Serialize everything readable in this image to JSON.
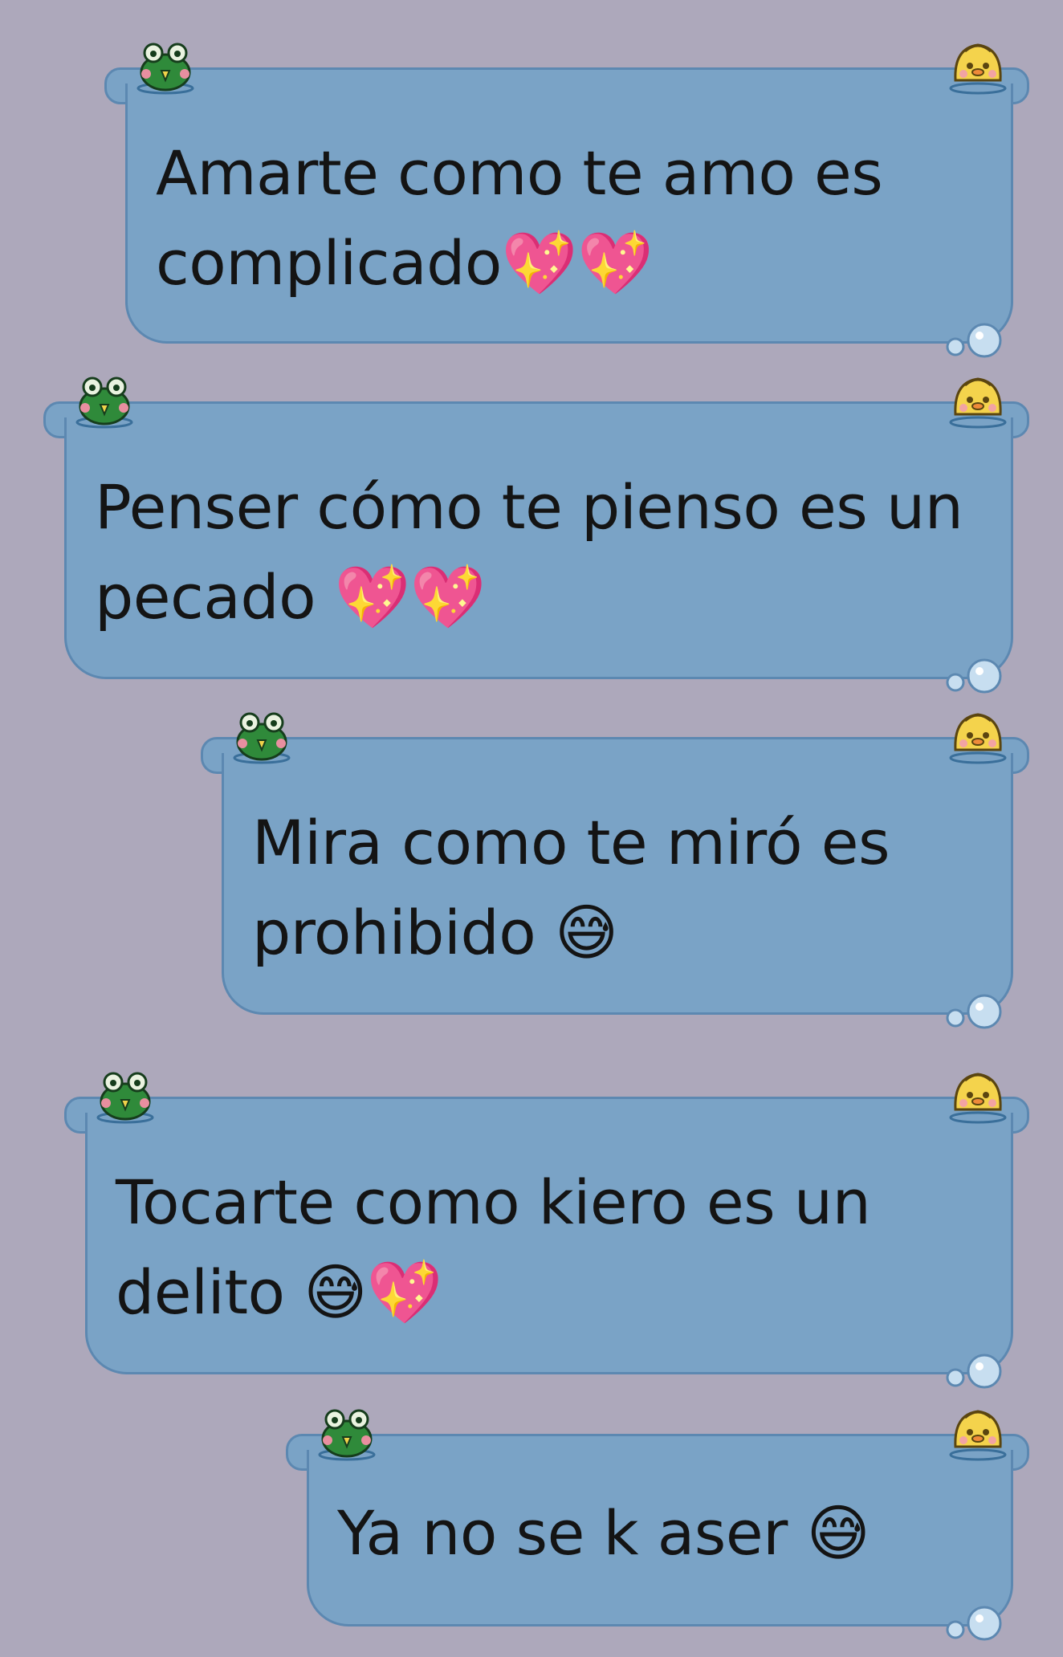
{
  "messages": [
    {
      "text": "Amarte como te amo es complicado💖💖"
    },
    {
      "text": "Penser cómo te pienso es un pecado 💖💖"
    },
    {
      "text": "Mira como te miró es prohibido 😅"
    },
    {
      "text": "Tocarte como kiero es un delito 😅💖"
    },
    {
      "text": "Ya no se k aser 😅"
    }
  ],
  "decorations": {
    "left_sticker": "frog-icon",
    "right_sticker": "duck-icon",
    "corner": "bubbles-icon"
  },
  "colors": {
    "background": "#ada8bb",
    "bubble": "#7aa3c6",
    "bubble_border": "#5c88b1",
    "text": "#141414"
  }
}
